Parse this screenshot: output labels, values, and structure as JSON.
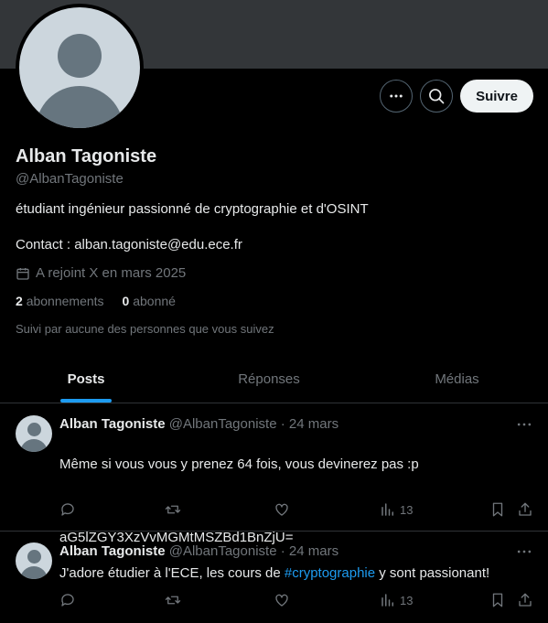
{
  "profile": {
    "name": "Alban Tagoniste",
    "handle": "@AlbanTagoniste",
    "bio": "étudiant ingénieur passionné de cryptographie et d'OSINT",
    "contact": "Contact : alban.tagoniste@edu.ece.fr",
    "joined": "A rejoint X en mars 2025",
    "following_count": "2",
    "following_label": "abonnements",
    "followers_count": "0",
    "followers_label": "abonné",
    "followed_by": "Suivi par aucune des personnes que vous suivez"
  },
  "header": {
    "follow_label": "Suivre",
    "more_icon": "more-icon",
    "search_icon": "search-icon"
  },
  "tabs": [
    {
      "label": "Posts",
      "active": true
    },
    {
      "label": "Réponses",
      "active": false
    },
    {
      "label": "Médias",
      "active": false
    }
  ],
  "posts": [
    {
      "author": "Alban Tagoniste",
      "handle": "@AlbanTagoniste",
      "date": "24 mars",
      "text_line1": "Même si vous vous y prenez 64 fois, vous devinerez pas :p",
      "text_line2": "aG5lZGY3XzVvMGMtMSZBd1BnZjU=",
      "views": "13"
    },
    {
      "author": "Alban Tagoniste",
      "handle": "@AlbanTagoniste",
      "date": "24 mars",
      "text_before": "J'adore étudier à l'ECE, les cours de ",
      "hashtag": "#cryptographie",
      "text_after": " y sont passionant!",
      "views": "13"
    }
  ],
  "colors": {
    "background": "#000000",
    "banner": "#333639",
    "accent": "#1d9bf0",
    "muted_text": "#71767b"
  }
}
